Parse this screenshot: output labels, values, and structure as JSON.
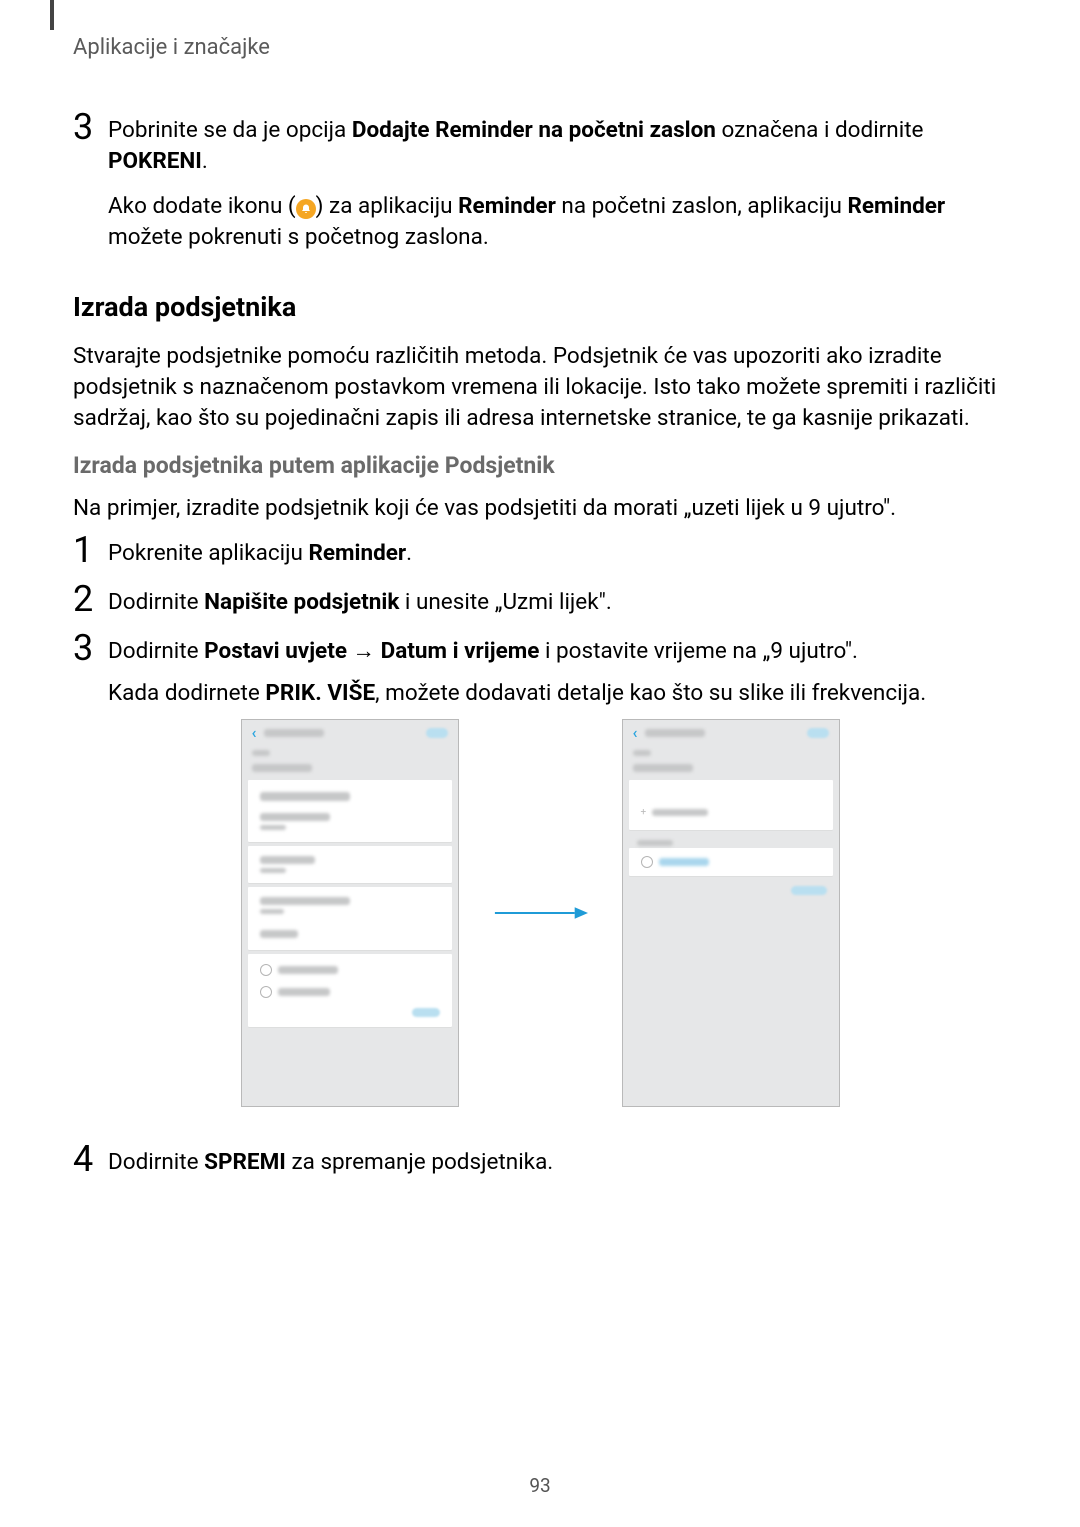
{
  "header": {
    "running": "Aplikacije i značajke"
  },
  "step3": {
    "num": "3",
    "text_before": "Pobrinite se da je opcija ",
    "bold1": "Dodajte Reminder na početni zaslon",
    "text_mid": " označena i dodirnite ",
    "bold2": "POKRENI",
    "period": ".",
    "sub_before": "Ako dodate ikonu (",
    "sub_after1": ") za aplikaciju ",
    "sub_bold1": "Reminder",
    "sub_after2": " na početni zaslon, aplikaciju ",
    "sub_bold2": "Reminder",
    "sub_after3": " možete pokrenuti s početnog zaslona."
  },
  "section": {
    "title": "Izrada podsjetnika",
    "p1": "Stvarajte podsjetnike pomoću različitih metoda. Podsjetnik će vas upozoriti ako izradite podsjetnik s naznačenom postavkom vremena ili lokacije. Isto tako možete spremiti i različiti sadržaj, kao što su pojedinačni zapis ili adresa internetske stranice, te ga kasnije prikazati.",
    "sub": "Izrada podsjetnika putem aplikacije Podsjetnik",
    "p2": "Na primjer, izradite podsjetnik koji će vas podsjetiti da morati „uzeti lijek u 9 ujutro\"."
  },
  "steps": {
    "s1": {
      "num": "1",
      "before": "Pokrenite aplikaciju ",
      "bold": "Reminder",
      "after": "."
    },
    "s2": {
      "num": "2",
      "before": "Dodirnite ",
      "bold": "Napišite podsjetnik",
      "after": " i unesite „Uzmi lijek\"."
    },
    "s3": {
      "num": "3",
      "before": "Dodirnite ",
      "bold1": "Postavi uvjete",
      "arrow": " → ",
      "bold2": "Datum i vrijeme",
      "after": " i postavite vrijeme na „9 ujutro\".",
      "line2_before": "Kada dodirnete ",
      "line2_bold": "PRIK. VIŠE",
      "line2_after": ", možete dodavati detalje kao što su slike ili frekvencija."
    },
    "s4": {
      "num": "4",
      "before": "Dodirnite ",
      "bold": "SPREMI",
      "after": " za spremanje podsjetnika."
    }
  },
  "page_number": "93"
}
